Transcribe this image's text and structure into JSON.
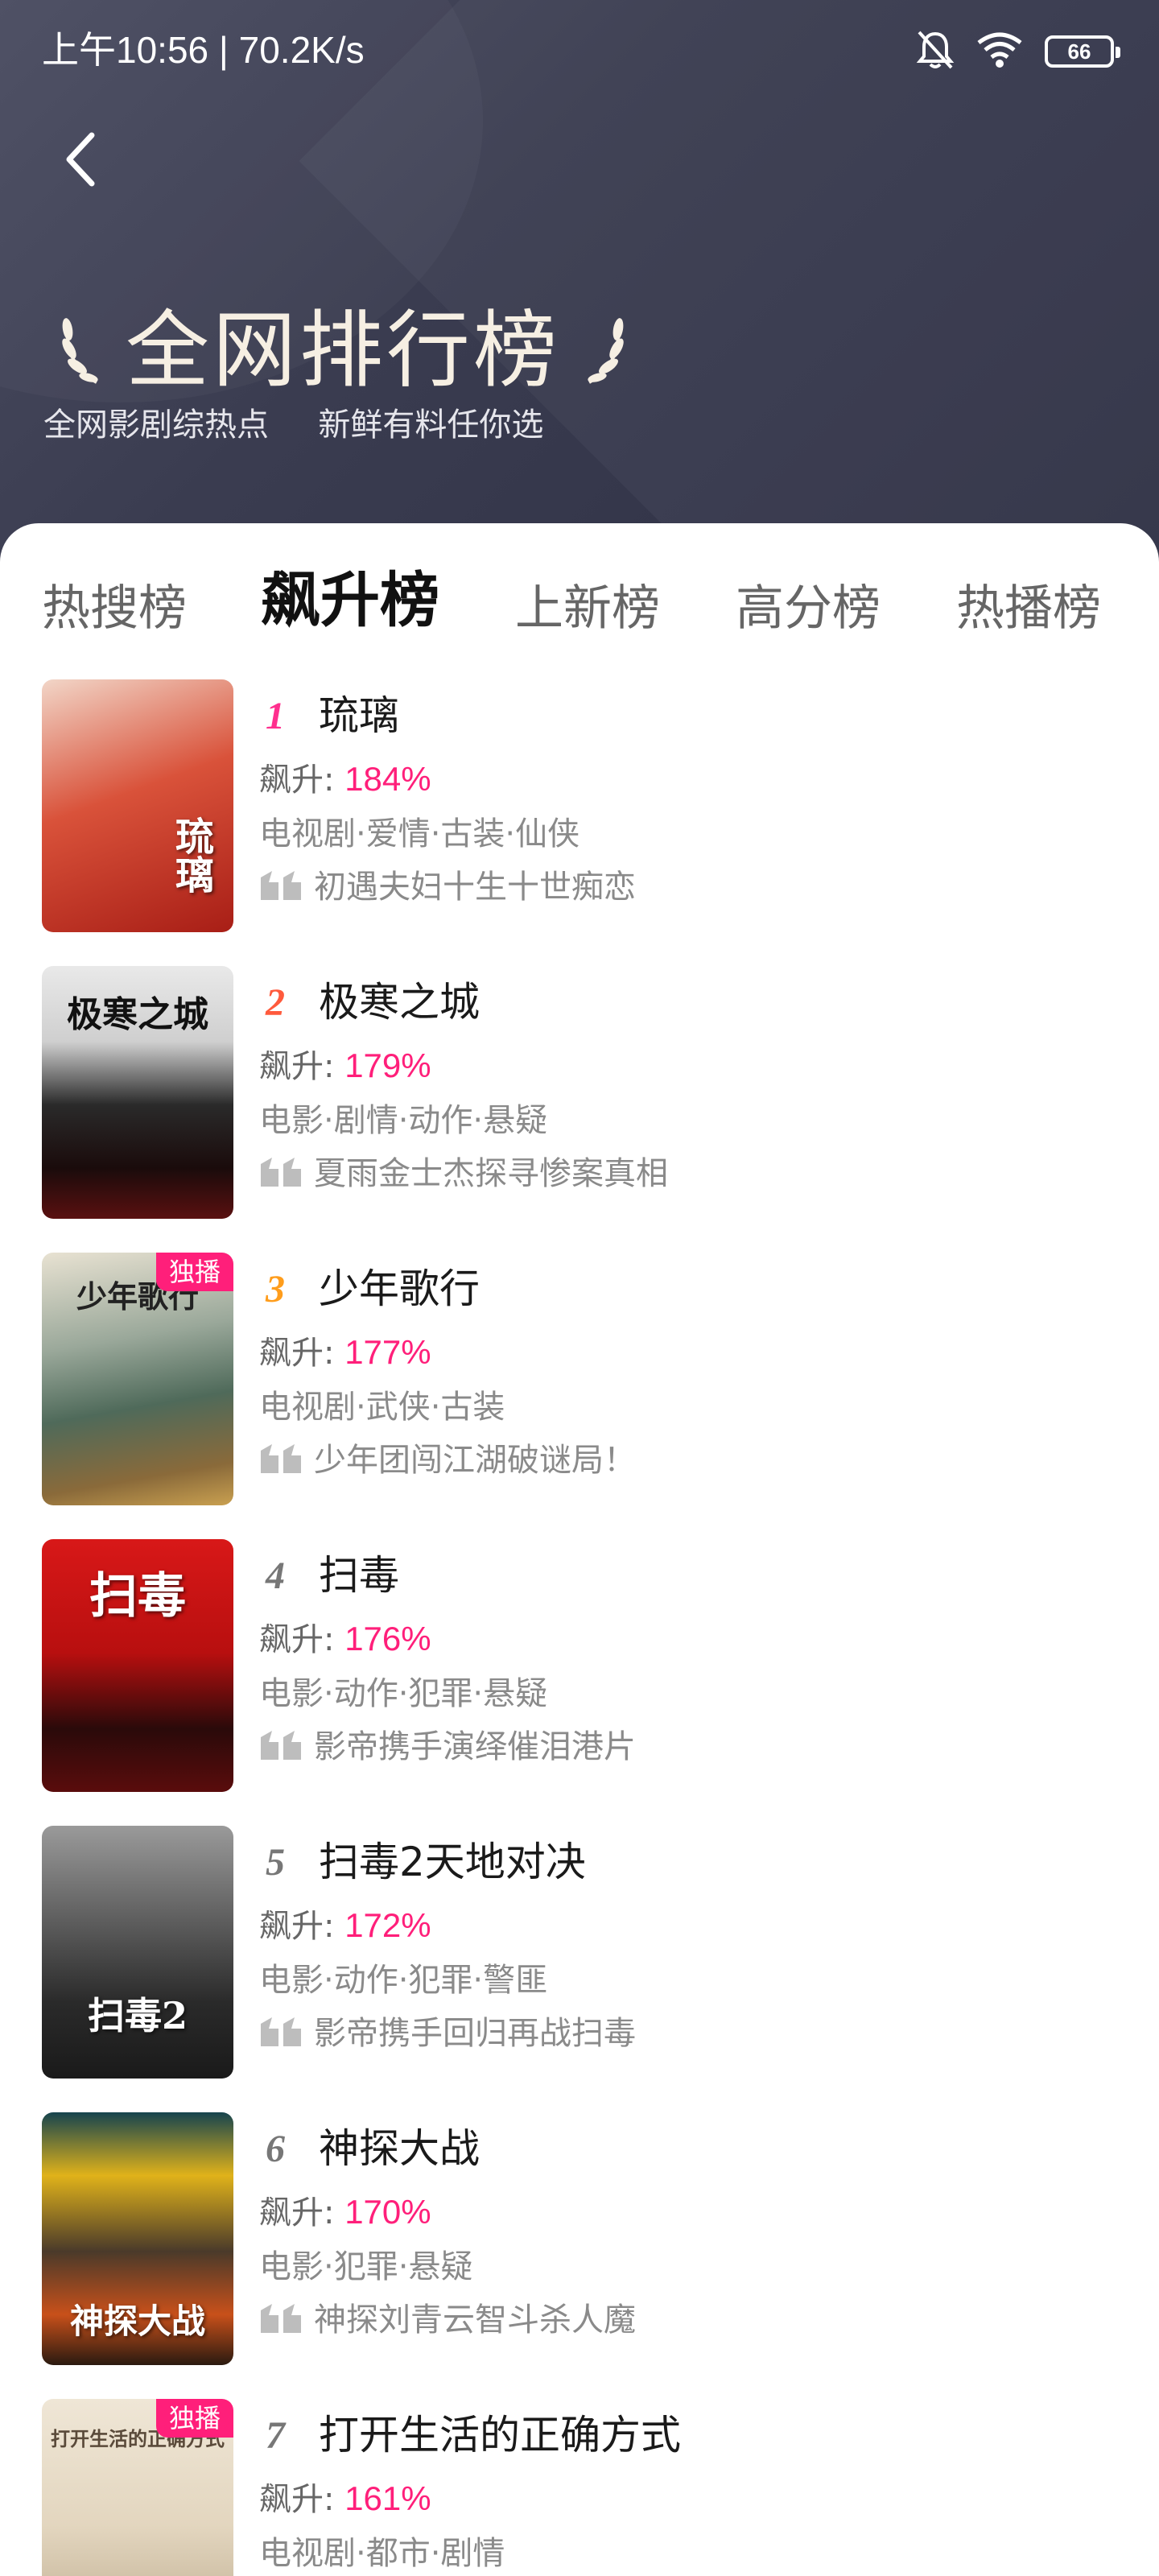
{
  "status_bar": {
    "time_speed": "上午10:56 | 70.2K/s",
    "battery": "66"
  },
  "header": {
    "title": "全网排行榜",
    "subtitle": "全网影剧综热点  新鲜有料任你选"
  },
  "tabs": [
    {
      "label": "热搜榜"
    },
    {
      "label": "飙升榜"
    },
    {
      "label": "上新榜"
    },
    {
      "label": "高分榜"
    },
    {
      "label": "热播榜"
    }
  ],
  "active_tab": "飙升榜",
  "rise_label": "飙升: ",
  "items": [
    {
      "rank": "1",
      "title": "琉璃",
      "rise": "184%",
      "tags": "电视剧·爱情·古装·仙侠",
      "quote": "初遇夫妇十生十世痴恋",
      "badge": "",
      "poster_text": "琉璃"
    },
    {
      "rank": "2",
      "title": "极寒之城",
      "rise": "179%",
      "tags": "电影·剧情·动作·悬疑",
      "quote": "夏雨金士杰探寻惨案真相",
      "badge": "",
      "poster_text": "极寒之城"
    },
    {
      "rank": "3",
      "title": "少年歌行",
      "rise": "177%",
      "tags": "电视剧·武侠·古装",
      "quote": "少年团闯江湖破谜局！",
      "badge": "独播",
      "poster_text": "少年歌行"
    },
    {
      "rank": "4",
      "title": "扫毒",
      "rise": "176%",
      "tags": "电影·动作·犯罪·悬疑",
      "quote": "影帝携手演绎催泪港片",
      "badge": "",
      "poster_text": "扫毒"
    },
    {
      "rank": "5",
      "title": "扫毒2天地对决",
      "rise": "172%",
      "tags": "电影·动作·犯罪·警匪",
      "quote": "影帝携手回归再战扫毒",
      "badge": "",
      "poster_text": "扫毒2"
    },
    {
      "rank": "6",
      "title": "神探大战",
      "rise": "170%",
      "tags": "电影·犯罪·悬疑",
      "quote": "神探刘青云智斗杀人魔",
      "badge": "",
      "poster_text": "神探大战"
    },
    {
      "rank": "7",
      "title": "打开生活的正确方式",
      "rise": "161%",
      "tags": "电视剧·都市·剧情",
      "quote": "",
      "badge": "独播",
      "poster_text": "打开生活的正确方式"
    }
  ],
  "colors": {
    "accent": "#ff1f7a",
    "header_bg": "#3a3c50",
    "title": "#f6efe3"
  },
  "icons": {
    "back": "chevron-left-icon",
    "quote": "quote-icon",
    "laurel": "laurel-icon",
    "bell": "bell-off-icon",
    "wifi": "wifi-icon",
    "battery": "battery-icon"
  }
}
